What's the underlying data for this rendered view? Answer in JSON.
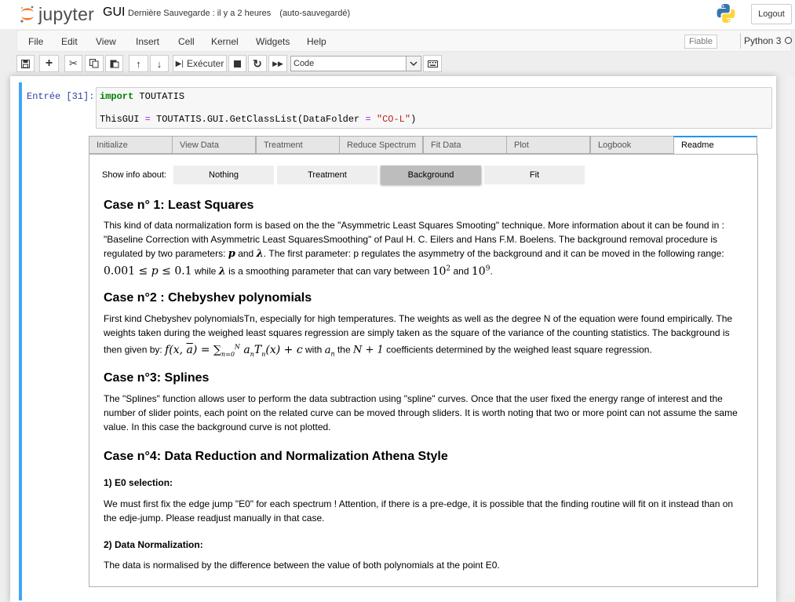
{
  "header": {
    "logo_text": "jupyter",
    "notebook_title": "GUI",
    "save_status": "Dernière Sauvegarde : il y a 2 heures",
    "autosave": "(auto-sauvegardé)",
    "logout_label": "Logout"
  },
  "menubar": {
    "items": [
      "File",
      "Edit",
      "View",
      "Insert",
      "Cell",
      "Kernel",
      "Widgets",
      "Help"
    ],
    "trusted_label": "Fiable",
    "kernel_name": "Python 3"
  },
  "toolbar": {
    "run_label": "Exécuter",
    "cell_type": "Code"
  },
  "cell": {
    "prompt": "Entrée [31]:",
    "code_line1_kw": "import",
    "code_line1_rest": " TOUTATIS",
    "code_line2_a": "ThisGUI ",
    "code_line2_op": "=",
    "code_line2_b": " TOUTATIS.GUI.GetClassList(DataFolder ",
    "code_line2_op2": "=",
    "code_line2_str": " \"CO-L\"",
    "code_line2_end": ")"
  },
  "widget": {
    "tabs": [
      "Initialize",
      "View Data",
      "Treatment",
      "Reduce Spectrum",
      "Fit Data",
      "Plot",
      "Logbook",
      "Readme"
    ],
    "active_tab": "Readme",
    "show_info_label": "Show info about:",
    "toggle_buttons": [
      "Nothing",
      "Treatment",
      "Background",
      "Fit"
    ],
    "selected_toggle": "Background"
  },
  "readme": {
    "case1_title": "Case n° 1: Least Squares",
    "case1_p1": "This kind of data normalization form is based on the the \"Asymmetric Least Squares Smooting\" technique. More information about it can be found in : \"Baseline Correction with Asymmetric Least SquaresSmoothing\" of Paul H. C. Eilers and Hans F.M. Boelens. The background removal procedure is regulated by two parameters:",
    "case1_p2": "and",
    "case1_p3": ". The first parameter: p regulates the asymmetry of the background and it can be moved in the following range:",
    "case1_p4": "while",
    "case1_p5": "is a smoothing parameter that can vary between",
    "case1_p6": "and",
    "case2_title": "Case n°2 : Chebyshev polynomials",
    "case2_p1": "First kind Chebyshev polynomialsTn, especially for high temperatures. The weights as well as the degree N of the equation were found empirically. The weights taken during the weighed least squares regression are simply taken as the square of the variance of the counting statistics. The background is then given by:",
    "case2_p2": "with",
    "case2_p3": "the",
    "case2_p4": "coefficients determined by the weighed least square regression.",
    "case3_title": "Case n°3: Splines",
    "case3_p": "The \"Splines\" function allows user to perform the data subtraction using \"spline\" curves. Once that the user fixed the energy range of interest and the number of slider points, each point on the related curve can be moved through sliders. It is worth noting that two or more point can not assume the same value. In this case the background curve is not plotted.",
    "case4_title": "Case n°4: Data Reduction and Normalization Athena Style",
    "case4_sub1": "1) E0 selection:",
    "case4_p1": "We must first fix the edge jump \"E0\" for each spectrum ! Attention, if there is a pre-edge, it is possible that the finding routine will fit on it instead than on the edje-jump. Please readjust manually in that case.",
    "case4_sub2": "2) Data Normalization:",
    "case4_p2": "The data is normalised by the difference between the value of both polynomials at the point E0."
  },
  "colors": {
    "cell_selected_bar": "#42a5f5",
    "active_tab_border": "#2196f3",
    "prompt_color": "#303f9f",
    "keyword_color": "#008000",
    "string_color": "#ba2121"
  }
}
